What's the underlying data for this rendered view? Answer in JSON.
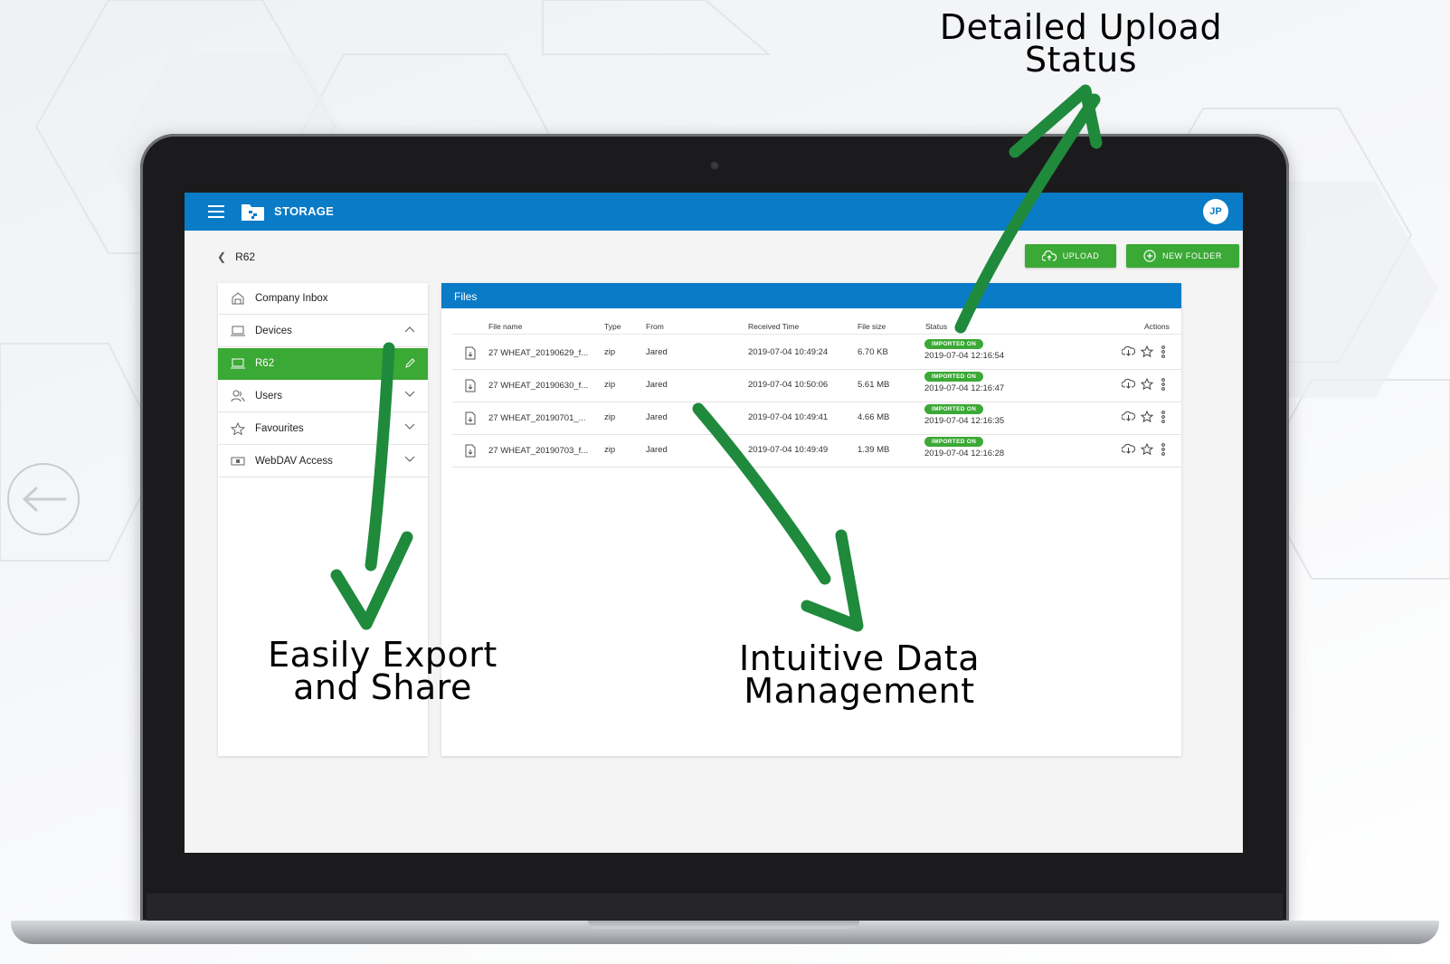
{
  "app": {
    "title": "STORAGE",
    "user_initials": "JP"
  },
  "breadcrumb": {
    "current": "R62"
  },
  "toolbar": {
    "upload_label": "UPLOAD",
    "new_folder_label": "NEW FOLDER"
  },
  "sidebar": {
    "items": [
      {
        "label": "Company Inbox",
        "icon": "inbox-icon"
      },
      {
        "label": "Devices",
        "icon": "laptop-icon",
        "expanded": true
      },
      {
        "label": "R62",
        "icon": "laptop-icon",
        "active": true
      },
      {
        "label": "Users",
        "icon": "users-icon"
      },
      {
        "label": "Favourites",
        "icon": "star-icon"
      },
      {
        "label": "WebDAV Access",
        "icon": "drive-icon"
      }
    ]
  },
  "files": {
    "panel_title": "Files",
    "columns": [
      "File name",
      "Type",
      "From",
      "Received Time",
      "File size",
      "Status",
      "Actions"
    ],
    "rows": [
      {
        "name": "27 WHEAT_20190629_f...",
        "type": "zip",
        "from": "Jared",
        "received": "2019-07-04 10:49:24",
        "size": "6.70 KB",
        "status": "IMPORTED ON",
        "status_time": "2019-07-04 12:16:54"
      },
      {
        "name": "27 WHEAT_20190630_f...",
        "type": "zip",
        "from": "Jared",
        "received": "2019-07-04 10:50:06",
        "size": "5.61 MB",
        "status": "IMPORTED ON",
        "status_time": "2019-07-04 12:16:47"
      },
      {
        "name": "27 WHEAT_20190701_...",
        "type": "zip",
        "from": "Jared",
        "received": "2019-07-04 10:49:41",
        "size": "4.66 MB",
        "status": "IMPORTED ON",
        "status_time": "2019-07-04 12:16:35"
      },
      {
        "name": "27 WHEAT_20190703_f...",
        "type": "zip",
        "from": "Jared",
        "received": "2019-07-04 10:49:49",
        "size": "1.39 MB",
        "status": "IMPORTED ON",
        "status_time": "2019-07-04 12:16:28"
      }
    ]
  },
  "annotations": {
    "upload_status": [
      "Detailed Upload",
      "Status"
    ],
    "export_share": [
      "Easily Export",
      "and Share"
    ],
    "data_management": [
      "Intuitive Data",
      "Management"
    ]
  },
  "colors": {
    "brand_blue": "#0a7bc6",
    "accent_green": "#3ba935",
    "arrow_green": "#1f8a3c"
  }
}
